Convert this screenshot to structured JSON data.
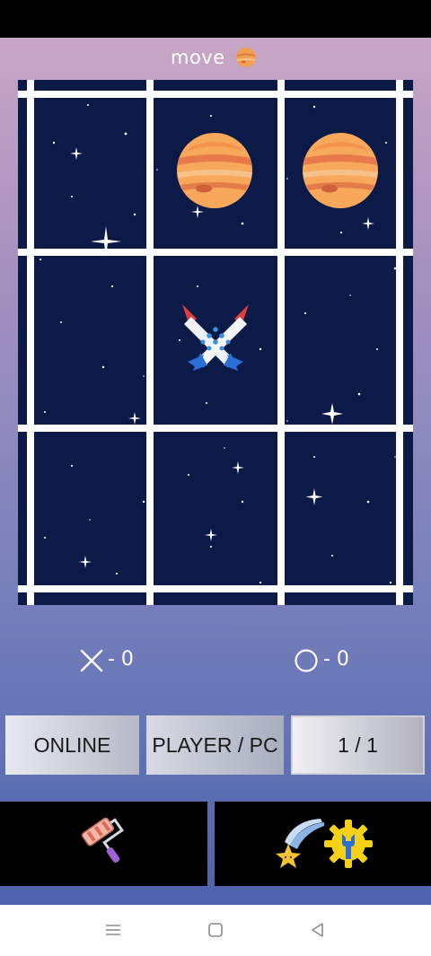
{
  "header": {
    "move_label": "move",
    "current_turn_icon": "planet-icon"
  },
  "board": {
    "rows": 3,
    "cols": 3,
    "cells": [
      [
        "",
        "O",
        "O"
      ],
      [
        "",
        "X",
        ""
      ],
      [
        "",
        "",
        ""
      ]
    ],
    "x_piece_icon": "crossed-rockets-icon",
    "o_piece_icon": "planet-icon",
    "background": "starry-space"
  },
  "score": {
    "x_icon": "x-mark-icon",
    "x_text": "- 0",
    "o_icon": "circle-icon",
    "o_text": "- 0"
  },
  "buttons": {
    "online": "ONLINE",
    "mode": "PLAYER / PC",
    "round": "1 / 1"
  },
  "panels": {
    "theme_icon": "paint-roller-icon",
    "settings_icons": [
      "shooting-star-icon",
      "gear-wrench-icon"
    ]
  },
  "nav": {
    "menu_icon": "menu-icon",
    "home_icon": "home-icon",
    "back_icon": "back-icon"
  },
  "colors": {
    "board_bg": "#0c1a48",
    "grid_lines": "#ffffff",
    "gradient_top": "#c9a6c6",
    "gradient_bottom": "#4d62ab"
  }
}
